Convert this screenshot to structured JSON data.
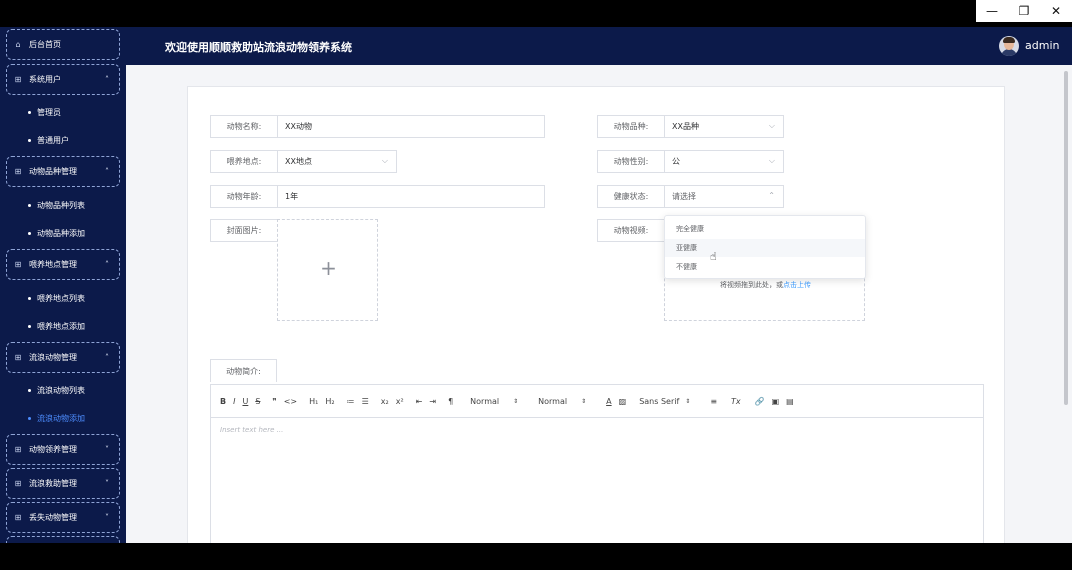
{
  "window": {
    "minimize_icon": "—",
    "restore_icon": "❐",
    "close_icon": "✕"
  },
  "header": {
    "title": "欢迎使用顺顺救助站流浪动物领养系统",
    "username": "admin"
  },
  "sidebar": {
    "menus": [
      {
        "icon": "home-icon",
        "glyph": "⌂",
        "label": "后台首页",
        "chevron": ""
      },
      {
        "icon": "grid-icon",
        "glyph": "⊞",
        "label": "系统用户",
        "chevron": "˄"
      },
      {
        "icon": "grid-icon",
        "glyph": "⊞",
        "label": "动物品种管理",
        "chevron": "˄"
      },
      {
        "icon": "grid-icon",
        "glyph": "⊞",
        "label": "喂养地点管理",
        "chevron": "˄"
      },
      {
        "icon": "grid-icon",
        "glyph": "⊞",
        "label": "流浪动物管理",
        "chevron": "˄"
      },
      {
        "icon": "grid-icon",
        "glyph": "⊞",
        "label": "动物领养管理",
        "chevron": "˅"
      },
      {
        "icon": "grid-icon",
        "glyph": "⊞",
        "label": "流浪救助管理",
        "chevron": "˅"
      },
      {
        "icon": "grid-icon",
        "glyph": "⊞",
        "label": "丢失动物管理",
        "chevron": "˅"
      }
    ],
    "subs": [
      {
        "label": "管理员",
        "active": false
      },
      {
        "label": "普通用户",
        "active": false
      },
      {
        "label": "动物品种列表",
        "active": false
      },
      {
        "label": "动物品种添加",
        "active": false
      },
      {
        "label": "喂养地点列表",
        "active": false
      },
      {
        "label": "喂养地点添加",
        "active": false
      },
      {
        "label": "流浪动物列表",
        "active": false
      },
      {
        "label": "流浪动物添加",
        "active": true
      }
    ]
  },
  "form": {
    "animal_name": {
      "label": "动物名称:",
      "value": "XX动物"
    },
    "animal_breed": {
      "label": "动物品种:",
      "value": "XX品种"
    },
    "feeding_place": {
      "label": "喂养地点:",
      "value": "XX地点"
    },
    "animal_gender": {
      "label": "动物性别:",
      "value": "公"
    },
    "animal_age": {
      "label": "动物年龄:",
      "value": "1年"
    },
    "health_status": {
      "label": "健康状态:",
      "placeholder": "请选择"
    },
    "cover_image": {
      "label": "封面图片:",
      "plus": "+"
    },
    "animal_video": {
      "label": "动物视频:",
      "hint": "将视频拖到此处，或",
      "hint_link": "点击上传"
    },
    "intro": {
      "label": "动物简介:"
    }
  },
  "health_options": [
    "完全健康",
    "亚健康",
    "不健康"
  ],
  "editor": {
    "placeholder": "Insert text here ...",
    "header_select": "Normal",
    "size_select": "Normal",
    "font_select": "Sans Serif",
    "tools": {
      "bold": "B",
      "italic": "I",
      "underline": "U",
      "strike": "S",
      "quote": "❞",
      "code": "<>",
      "h1": "H₁",
      "h2": "H₂",
      "ordered_list": "≔",
      "bullet_list": "☰",
      "sub": "x₂",
      "sup": "x²",
      "outdent": "⇤",
      "indent": "⇥",
      "direction": "¶",
      "color": "A",
      "background": "▨",
      "align": "≡",
      "clean": "Tx",
      "link": "🔗",
      "image": "▣",
      "video": "▤"
    }
  },
  "colors": {
    "sidebar": "#0c1a4a",
    "active": "#4d8dff",
    "link": "#409eff"
  }
}
